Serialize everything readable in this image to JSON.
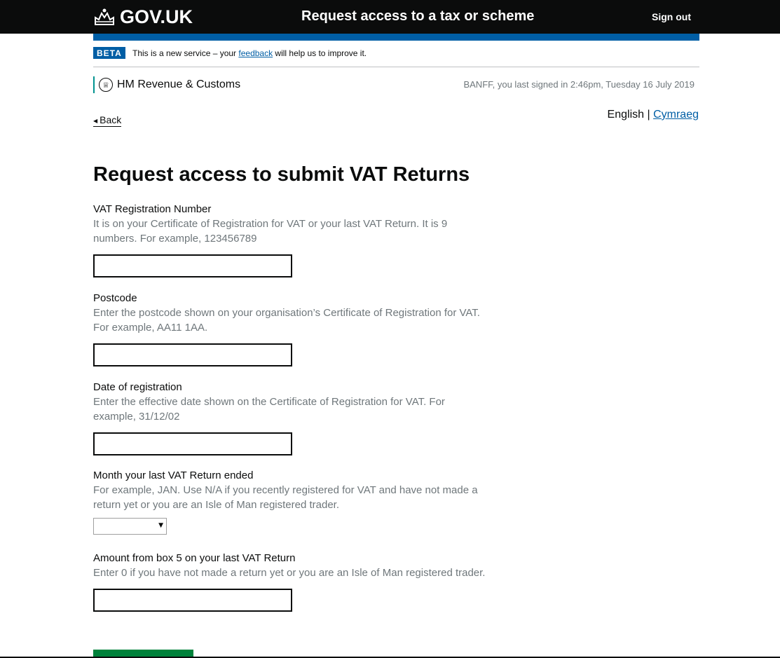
{
  "header": {
    "brand": "GOV.UK",
    "service_name": "Request access to a tax or scheme",
    "sign_out": "Sign out"
  },
  "phase_banner": {
    "tag": "BETA",
    "text_before": "This is a new service – your ",
    "link": "feedback",
    "text_after": " will help us to improve it."
  },
  "department": {
    "name": "HM Revenue & Customs",
    "last_signed_in": "BANFF, you last signed in 2:46pm, Tuesday 16 July 2019"
  },
  "nav": {
    "back": "Back",
    "lang_current": "English",
    "lang_separator": "|",
    "lang_other": "Cymraeg"
  },
  "page": {
    "title": "Request access to submit VAT Returns"
  },
  "form": {
    "vrn": {
      "label": "VAT Registration Number",
      "hint": "It is on your Certificate of Registration for VAT or your last VAT Return. It is 9 numbers. For example, 123456789",
      "value": ""
    },
    "postcode": {
      "label": "Postcode",
      "hint": "Enter the postcode shown on your organisation’s Certificate of Registration for VAT. For example, AA11 1AA.",
      "value": ""
    },
    "reg_date": {
      "label": "Date of registration",
      "hint": "Enter the effective date shown on the Certificate of Registration for VAT. For example, 31/12/02",
      "value": ""
    },
    "last_month": {
      "label": "Month your last VAT Return ended",
      "hint": "For example, JAN. Use N/A if you recently registered for VAT and have not made a return yet or you are an Isle of Man registered trader.",
      "selected": ""
    },
    "box5": {
      "label": "Amount from box 5 on your last VAT Return",
      "hint": "Enter 0 if you have not made a return yet or you are an Isle of Man registered trader.",
      "value": ""
    }
  },
  "colors": {
    "header_bg": "#0b0c0c",
    "stripe": "#005ea5",
    "hint": "#6f777b",
    "button": "#00823b",
    "hmrc_border": "#009390"
  },
  "icons": {
    "brand": "crown-icon",
    "department": "hmrc-crest-icon",
    "back": "triangle-left-icon",
    "select": "triangle-down-icon"
  }
}
